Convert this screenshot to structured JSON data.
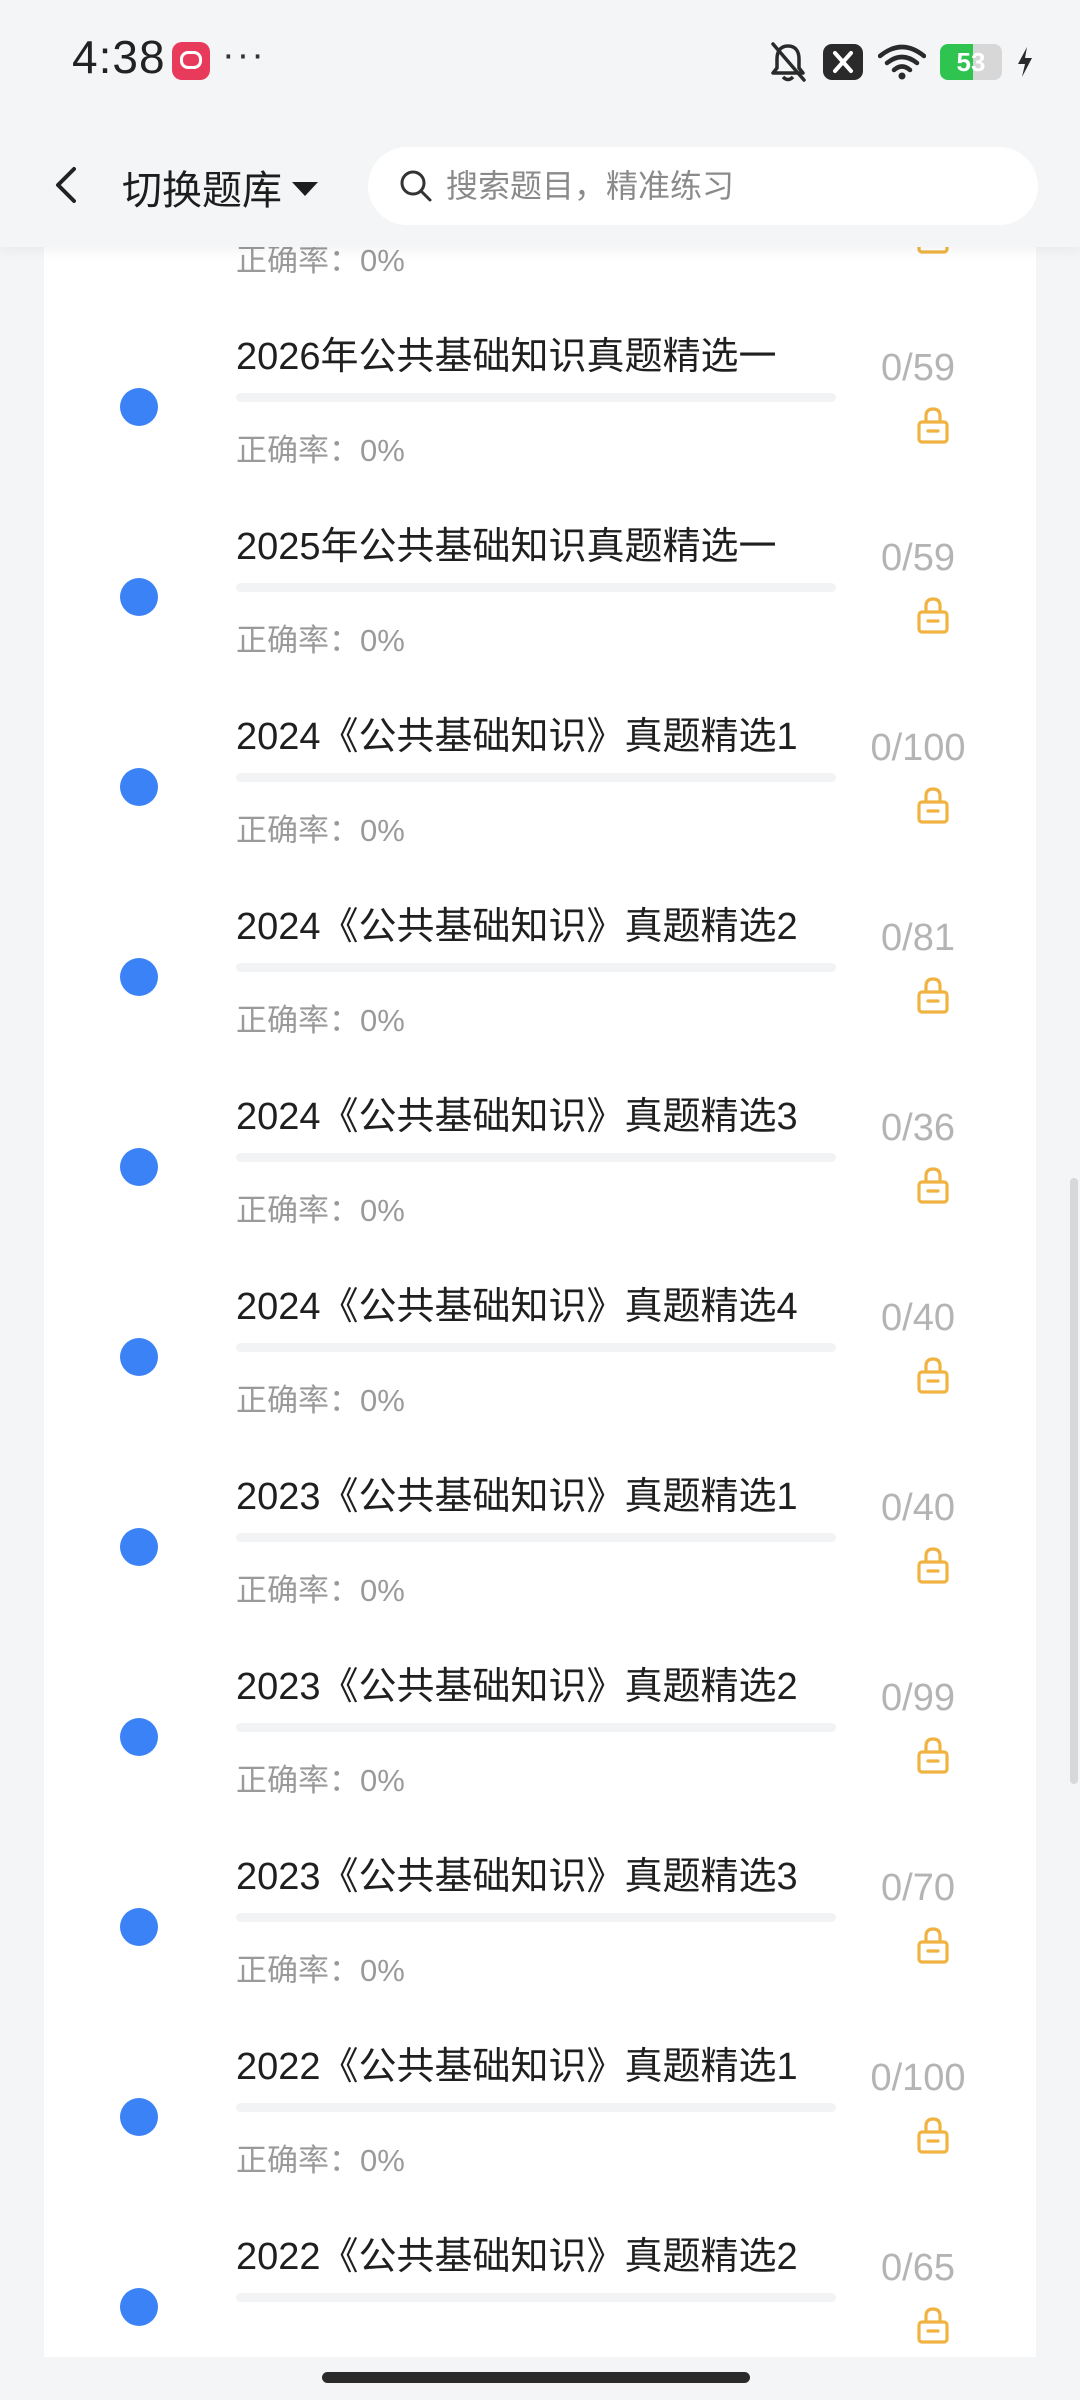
{
  "status_bar": {
    "time": "4:38",
    "more": "···",
    "battery": "53",
    "battery_level": 0.53
  },
  "header": {
    "switch_label": "切换题库",
    "search_placeholder": "搜索题目，精准练习"
  },
  "list": {
    "accuracy_prefix": "正确率：",
    "items": [
      {
        "title": "",
        "accuracy": "0%",
        "count": "",
        "progress": 0
      },
      {
        "title": "2026年公共基础知识真题精选一",
        "accuracy": "0%",
        "count": "0/59",
        "progress": 0
      },
      {
        "title": "2025年公共基础知识真题精选一",
        "accuracy": "0%",
        "count": "0/59",
        "progress": 0
      },
      {
        "title": "2024《公共基础知识》真题精选1",
        "accuracy": "0%",
        "count": "0/100",
        "progress": 0
      },
      {
        "title": "2024《公共基础知识》真题精选2",
        "accuracy": "0%",
        "count": "0/81",
        "progress": 0
      },
      {
        "title": "2024《公共基础知识》真题精选3",
        "accuracy": "0%",
        "count": "0/36",
        "progress": 0
      },
      {
        "title": "2024《公共基础知识》真题精选4",
        "accuracy": "0%",
        "count": "0/40",
        "progress": 0
      },
      {
        "title": "2023《公共基础知识》真题精选1",
        "accuracy": "0%",
        "count": "0/40",
        "progress": 0
      },
      {
        "title": "2023《公共基础知识》真题精选2",
        "accuracy": "0%",
        "count": "0/99",
        "progress": 0
      },
      {
        "title": "2023《公共基础知识》真题精选3",
        "accuracy": "0%",
        "count": "0/70",
        "progress": 0
      },
      {
        "title": "2022《公共基础知识》真题精选1",
        "accuracy": "0%",
        "count": "0/100",
        "progress": 0
      },
      {
        "title": "2022《公共基础知识》真题精选2",
        "accuracy": "",
        "count": "0/65",
        "progress": 0
      }
    ]
  },
  "colors": {
    "accent": "#3b82f6",
    "lock": "#f0b341",
    "count_text": "#b4b4b4",
    "page_bg": "#f4f5f7"
  },
  "icons": {
    "back": "chevron-left-icon",
    "caret": "caret-down-icon",
    "search": "search-icon",
    "lock": "lock-icon",
    "bell_muted": "bell-off-icon",
    "sim_off": "sim-off-icon",
    "wifi": "wifi-icon",
    "charging": "bolt-icon"
  }
}
